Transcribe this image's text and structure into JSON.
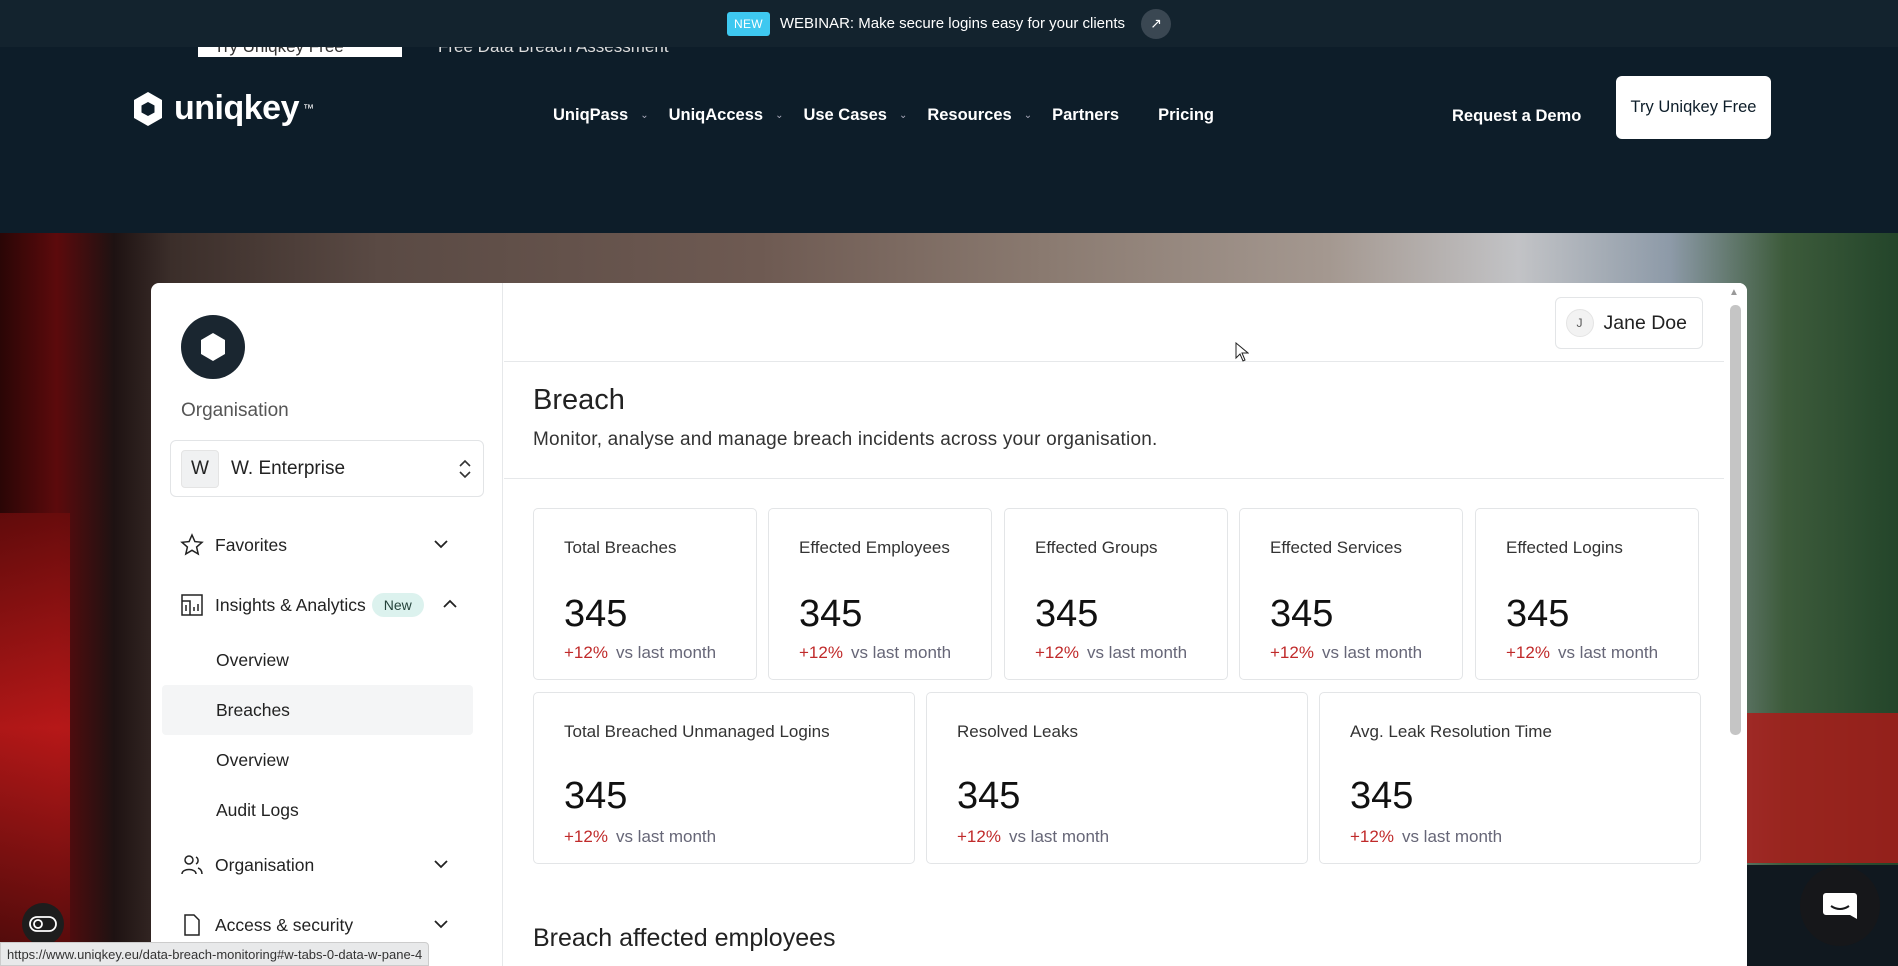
{
  "announcement": {
    "badge": "NEW",
    "text": "WEBINAR: Make secure logins easy for your clients"
  },
  "header": {
    "ghost_left": "Try Uniqkey Free",
    "ghost_right": "Free Data Breach Assessment",
    "brand": "uniqkey",
    "brand_tm": "™",
    "nav": [
      {
        "label": "UniqPass",
        "dropdown": true
      },
      {
        "label": "UniqAccess",
        "dropdown": true
      },
      {
        "label": "Use Cases",
        "dropdown": true
      },
      {
        "label": "Resources",
        "dropdown": true
      },
      {
        "label": "Partners",
        "dropdown": false
      },
      {
        "label": "Pricing",
        "dropdown": false
      }
    ],
    "request_demo": "Request a Demo",
    "try_free": "Try Uniqkey Free"
  },
  "sidebar": {
    "org_label": "Organisation",
    "org_avatar": "W",
    "org_name": "W. Enterprise",
    "favorites": "Favorites",
    "insights": "Insights & Analytics",
    "insights_badge": "New",
    "sub_items": [
      "Overview",
      "Breaches",
      "Overview",
      "Audit Logs"
    ],
    "organisation": "Organisation",
    "access": "Access & security"
  },
  "user": {
    "initial": "J",
    "name": "Jane Doe"
  },
  "page": {
    "title": "Breach",
    "subtitle": "Monitor, analyse and manage breach incidents across your organisation.",
    "section_title": "Breach affected employees"
  },
  "stats_row1": [
    {
      "title": "Total Breaches",
      "value": "345",
      "delta": "+12%",
      "suffix": "vs last month"
    },
    {
      "title": "Effected Employees",
      "value": "345",
      "delta": "+12%",
      "suffix": "vs last month"
    },
    {
      "title": "Effected Groups",
      "value": "345",
      "delta": "+12%",
      "suffix": "vs last month"
    },
    {
      "title": "Effected Services",
      "value": "345",
      "delta": "+12%",
      "suffix": "vs last month"
    },
    {
      "title": "Effected Logins",
      "value": "345",
      "delta": "+12%",
      "suffix": "vs last month"
    }
  ],
  "stats_row2": [
    {
      "title": "Total Breached Unmanaged Logins",
      "value": "345",
      "delta": "+12%",
      "suffix": "vs last month"
    },
    {
      "title": "Resolved Leaks",
      "value": "345",
      "delta": "+12%",
      "suffix": "vs last month"
    },
    {
      "title": "Avg. Leak Resolution Time",
      "value": "345",
      "delta": "+12%",
      "suffix": "vs last month"
    }
  ],
  "status_url": "https://www.uniqkey.eu/data-breach-monitoring#w-tabs-0-data-w-pane-4",
  "colors": {
    "accent_badge": "#3ec8f0",
    "delta": "#c02a2a",
    "header_bg": "#0d1d29"
  }
}
